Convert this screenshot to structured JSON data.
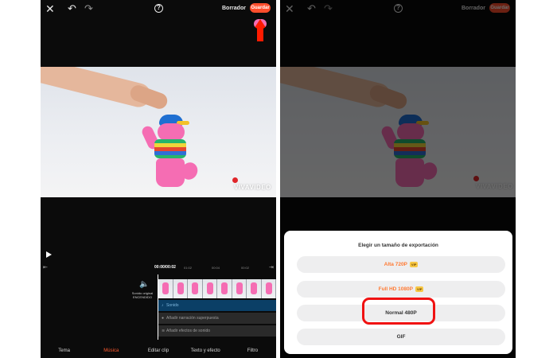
{
  "editor": {
    "close_icon": "close-icon",
    "undo_icon": "undo-icon",
    "redo_icon": "redo-icon",
    "help_icon": "help-icon",
    "draft_label": "Borrador",
    "save_label": "Guardar",
    "watermark": "VIVAVIDEO",
    "timeline": {
      "timecode": "00:00/00:02",
      "ticks": [
        "01:02",
        "00:04",
        "00:02"
      ],
      "original_sound": "Sonido original ENCENDIDO",
      "tracks": [
        "Sonido",
        "Añadir narración superpuesta",
        "Añadir efectos de sonido"
      ]
    },
    "nav": [
      "Tema",
      "Música",
      "Editar clip",
      "Texto y efecto",
      "Filtro"
    ],
    "active_nav": "Música"
  },
  "export_sheet": {
    "title": "Elegir un tamaño de exportación",
    "options": [
      {
        "label": "Alta 720P",
        "badge": "VIP"
      },
      {
        "label": "Full HD 1080P",
        "badge": "VIP"
      },
      {
        "label": "Normal 480P"
      },
      {
        "label": "GIF"
      }
    ]
  },
  "colors": {
    "accent": "#ff4e2c",
    "annotation": "#f01212"
  }
}
